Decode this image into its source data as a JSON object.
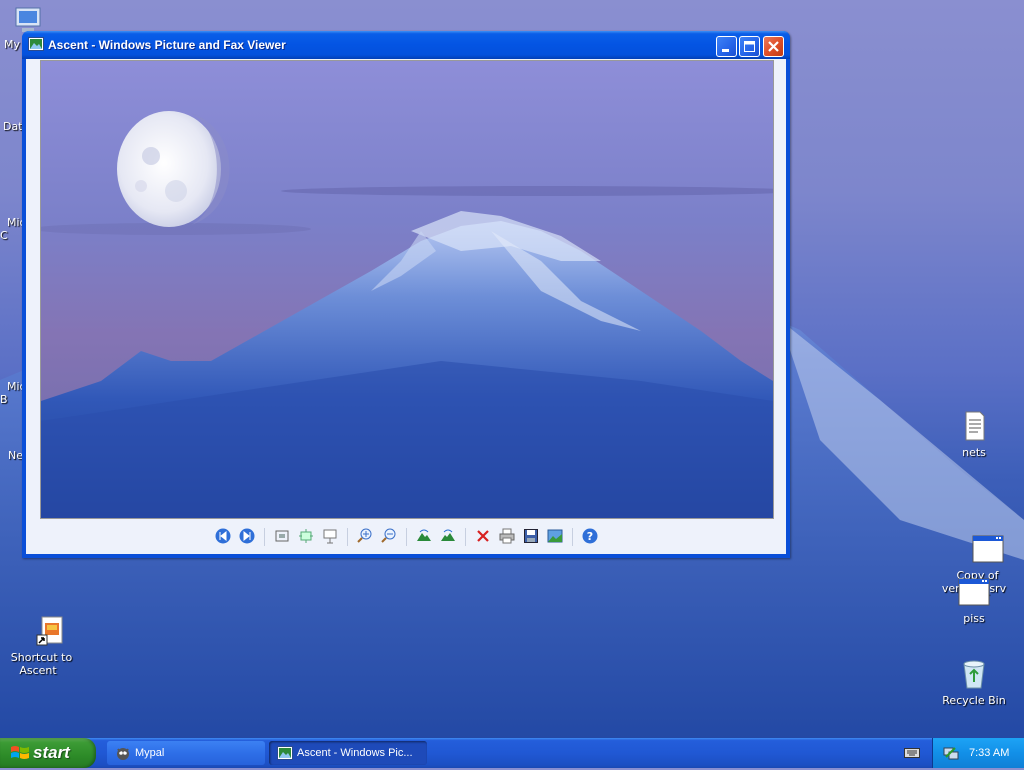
{
  "desktop": {
    "left_icons": [
      {
        "label": "My",
        "icon": "my-computer-icon"
      },
      {
        "label": "Dat",
        "icon": "data-icon"
      },
      {
        "label": "Micr\nC",
        "icon": "microsoft-icon"
      },
      {
        "label": "Micr\nB",
        "icon": "microsoft-b-icon"
      },
      {
        "label": "Ne",
        "icon": "network-icon"
      },
      {
        "label": "Shortcut to\nAscent",
        "icon": "shortcut-image-icon"
      }
    ],
    "right_icons": [
      {
        "label": "nets",
        "icon": "text-file-icon"
      },
      {
        "label": "Copy of\nventrilo_srv",
        "icon": "window-app-icon"
      },
      {
        "label": "piss",
        "icon": "window-app-icon"
      },
      {
        "label": "Recycle Bin",
        "icon": "recycle-bin-icon"
      }
    ]
  },
  "window": {
    "title": "Ascent - Windows Picture and Fax Viewer",
    "toolbar": [
      "previous-image-icon",
      "next-image-icon",
      "sep",
      "best-fit-icon",
      "actual-size-icon",
      "slideshow-icon",
      "sep",
      "zoom-in-icon",
      "zoom-out-icon",
      "sep",
      "rotate-clockwise-icon",
      "rotate-counterclockwise-icon",
      "sep",
      "delete-icon",
      "print-icon",
      "save-icon",
      "edit-icon",
      "sep",
      "help-icon"
    ]
  },
  "taskbar": {
    "start_label": "start",
    "buttons": [
      {
        "label": "Mypal",
        "icon": "mypal-icon"
      },
      {
        "label": "Ascent - Windows Pic...",
        "icon": "picture-viewer-icon"
      }
    ],
    "clock": "7:33 AM"
  }
}
